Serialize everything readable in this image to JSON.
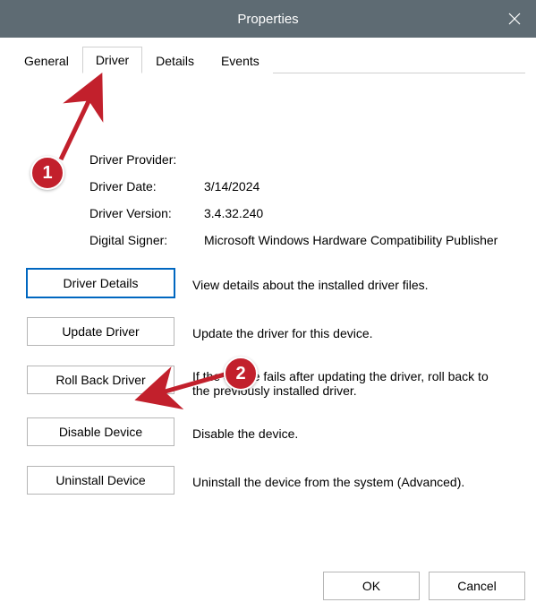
{
  "window": {
    "title": "Properties"
  },
  "tabs": {
    "general": "General",
    "driver": "Driver",
    "details": "Details",
    "events": "Events"
  },
  "info": {
    "provider_label": "Driver Provider:",
    "provider_value": "",
    "date_label": "Driver Date:",
    "date_value": "3/14/2024",
    "version_label": "Driver Version:",
    "version_value": "3.4.32.240",
    "signer_label": "Digital Signer:",
    "signer_value": "Microsoft Windows Hardware Compatibility Publisher"
  },
  "actions": {
    "details_btn": "Driver Details",
    "details_desc": "View details about the installed driver files.",
    "update_btn": "Update Driver",
    "update_desc": "Update the driver for this device.",
    "rollback_btn": "Roll Back Driver",
    "rollback_desc": "If the device fails after updating the driver, roll back to the previously installed driver.",
    "disable_btn": "Disable Device",
    "disable_desc": "Disable the device.",
    "uninstall_btn": "Uninstall Device",
    "uninstall_desc": "Uninstall the device from the system (Advanced)."
  },
  "dialog": {
    "ok": "OK",
    "cancel": "Cancel"
  },
  "annotations": {
    "marker1": "1",
    "marker2": "2"
  }
}
